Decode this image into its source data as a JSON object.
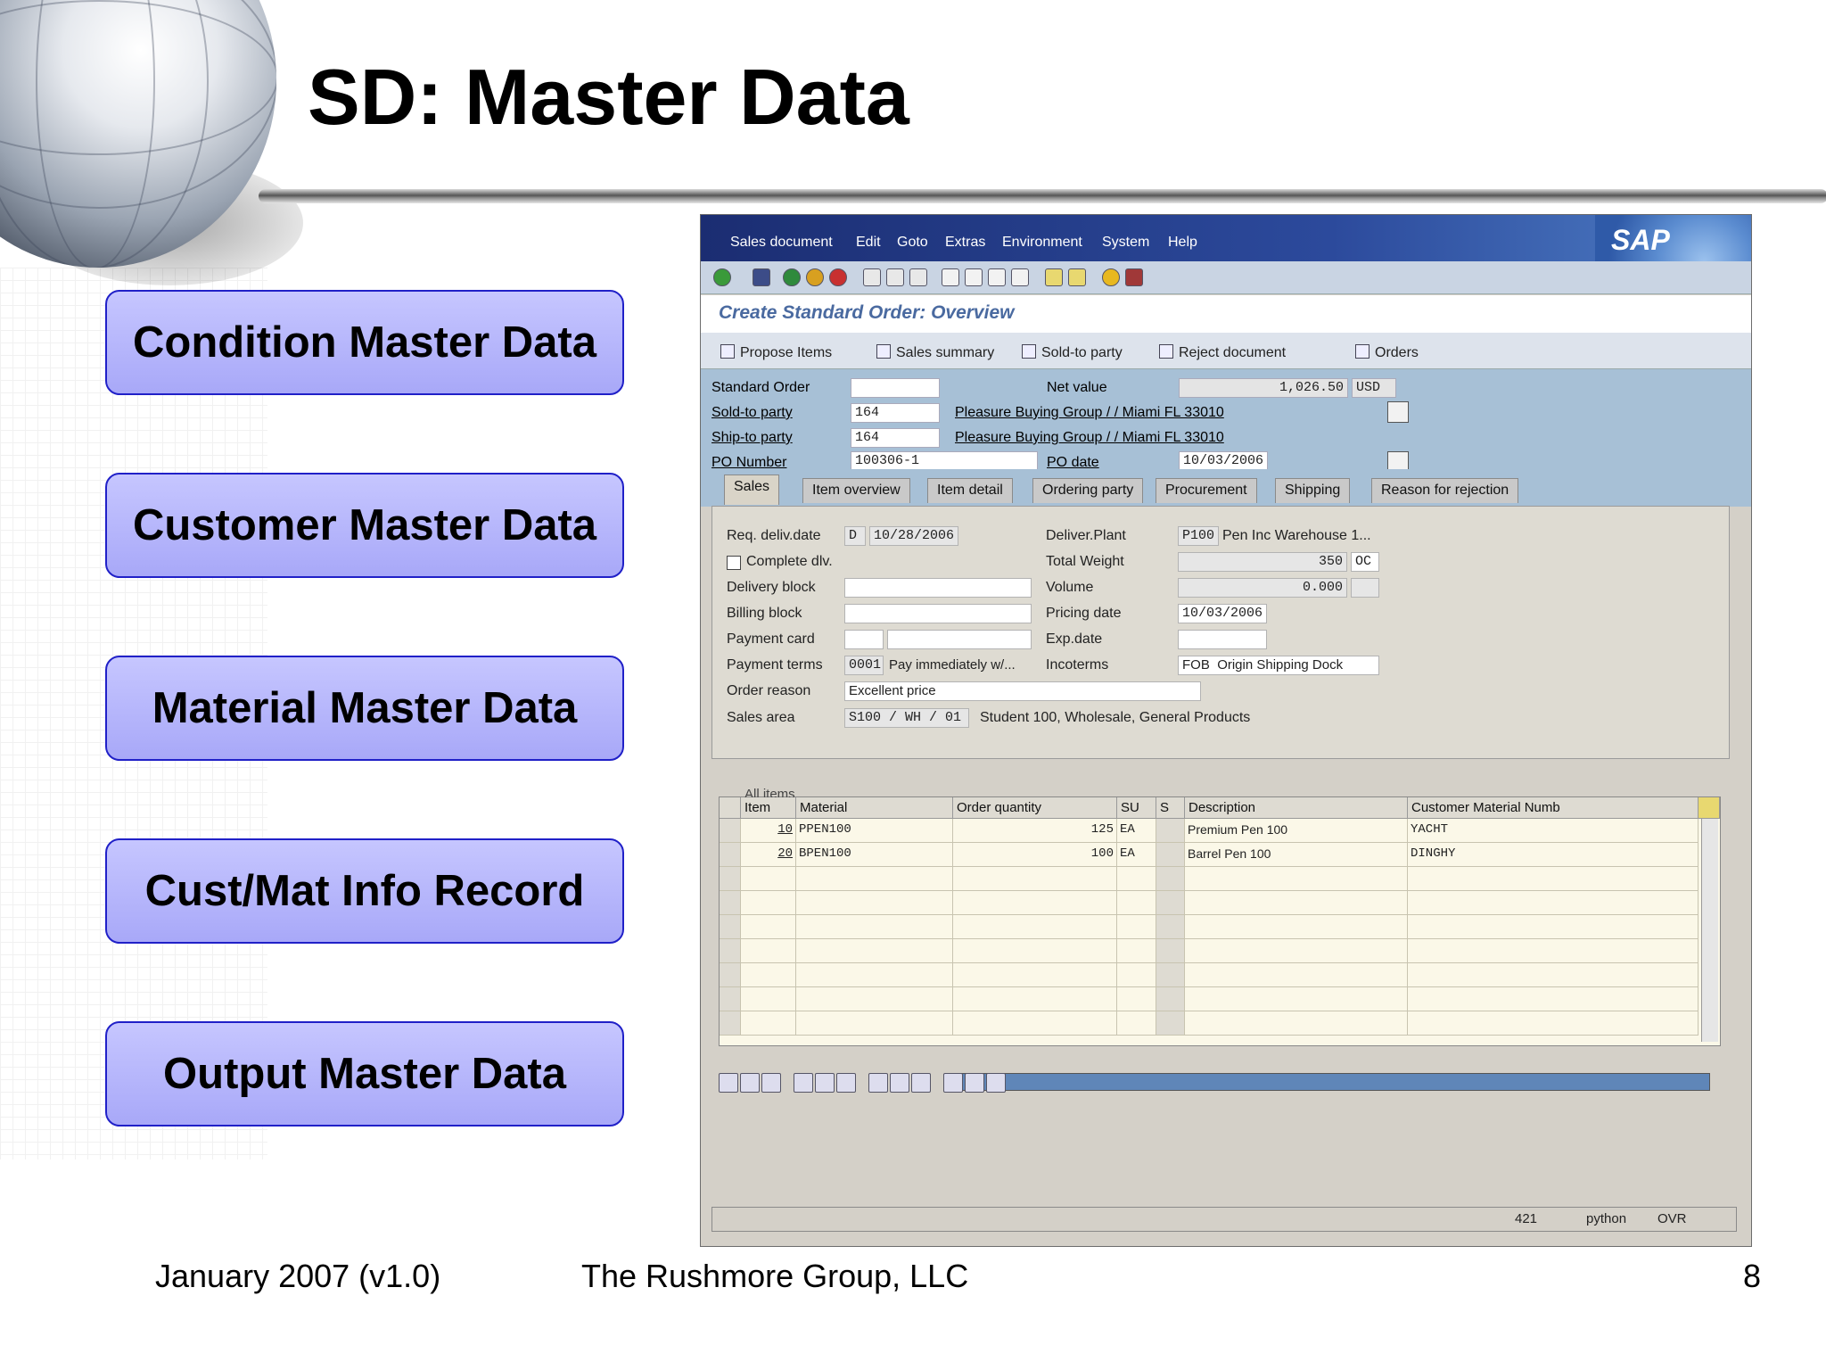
{
  "slide": {
    "title": "SD: Master Data",
    "buttons": [
      "Condition Master Data",
      "Customer Master Data",
      "Material Master Data",
      "Cust/Mat Info Record",
      "Output Master Data"
    ],
    "footer": {
      "date": "January 2007 (v1.0)",
      "company": "The Rushmore Group, LLC",
      "page": "8"
    }
  },
  "sap": {
    "menu": [
      "Sales document",
      "Edit",
      "Goto",
      "Extras",
      "Environment",
      "System",
      "Help"
    ],
    "logo": "SAP",
    "screen_title": "Create Standard Order: Overview",
    "app_toolbar": [
      "Propose Items",
      "Sales summary",
      "Sold-to party",
      "Reject document",
      "Orders"
    ],
    "header": {
      "standard_order_label": "Standard Order",
      "standard_order_value": "",
      "net_value_label": "Net value",
      "net_value": "1,026.50",
      "currency": "USD",
      "sold_to_label": "Sold-to party",
      "sold_to_value": "164",
      "sold_to_desc": "Pleasure Buying Group / / Miami FL 33010",
      "ship_to_label": "Ship-to party",
      "ship_to_value": "164",
      "ship_to_desc": "Pleasure Buying Group / / Miami FL 33010",
      "po_number_label": "PO Number",
      "po_number_value": "100306-1",
      "po_date_label": "PO date",
      "po_date_value": "10/03/2006"
    },
    "tabs": [
      "Sales",
      "Item overview",
      "Item detail",
      "Ordering party",
      "Procurement",
      "Shipping",
      "Reason for rejection"
    ],
    "sales": {
      "req_deliv_label": "Req. deliv.date",
      "req_deliv_type": "D",
      "req_deliv_value": "10/28/2006",
      "complete_dlv_label": "Complete dlv.",
      "delivery_block_label": "Delivery block",
      "billing_block_label": "Billing block",
      "payment_card_label": "Payment card",
      "payment_terms_label": "Payment terms",
      "payment_terms_value": "0001",
      "payment_terms_desc": "Pay immediately w/...",
      "order_reason_label": "Order reason",
      "order_reason_value": "Excellent price",
      "sales_area_label": "Sales area",
      "sales_area_value": "S100 / WH / 01",
      "sales_area_desc": "Student 100, Wholesale, General Products",
      "deliver_plant_label": "Deliver.Plant",
      "deliver_plant_value": "P100",
      "deliver_plant_desc": "Pen Inc Warehouse 1...",
      "total_weight_label": "Total Weight",
      "total_weight_value": "350",
      "total_weight_unit": "OC",
      "volume_label": "Volume",
      "volume_value": "0.000",
      "pricing_date_label": "Pricing date",
      "pricing_date_value": "10/03/2006",
      "exp_date_label": "Exp.date",
      "incoterms_label": "Incoterms",
      "incoterms_value": "FOB",
      "incoterms_desc": "Origin Shipping Dock"
    },
    "items": {
      "caption": "All items",
      "columns": [
        "Item",
        "Material",
        "Order quantity",
        "SU",
        "S",
        "Description",
        "Customer Material Numb"
      ],
      "rows": [
        {
          "item": "10",
          "material": "PPEN100",
          "qty": "125",
          "su": "EA",
          "desc": "Premium Pen 100",
          "cust": "YACHT"
        },
        {
          "item": "20",
          "material": "BPEN100",
          "qty": "100",
          "su": "EA",
          "desc": "Barrel Pen 100",
          "cust": "DINGHY"
        }
      ]
    },
    "status": {
      "session": "421",
      "server": "python",
      "mode": "OVR"
    }
  }
}
